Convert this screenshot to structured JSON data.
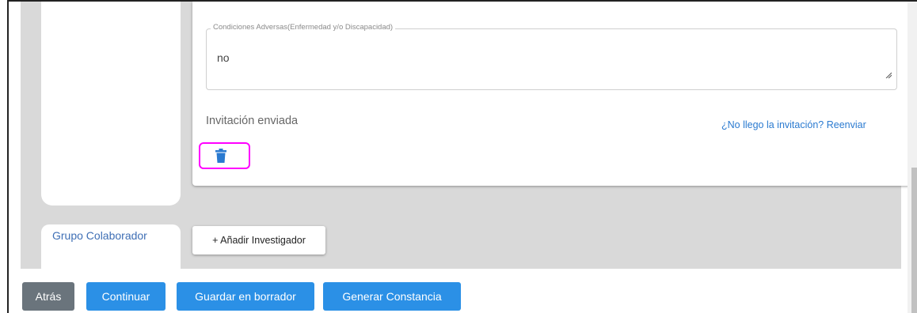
{
  "form": {
    "adverse_conditions": {
      "legend": "Condiciones Adversas(Enfermedad y/o Discapacidad)",
      "value": "no"
    },
    "invitation_status": "Invitación enviada",
    "resend_link": "¿No llego la invitación? Reenviar",
    "delete_icon": "trash-icon",
    "delete_highlight_color": "#ff00ff"
  },
  "group": {
    "label": "Grupo Colaborador",
    "add_button": "+ Añadir Investigador"
  },
  "footer": {
    "back": "Atrás",
    "continue": "Continuar",
    "save_draft": "Guardar en borrador",
    "generate_certificate": "Generar Constancia"
  },
  "colors": {
    "primary": "#2b90e6",
    "secondary": "#6a747c",
    "link": "#2a7ad0",
    "background": "#d9d9d9"
  }
}
